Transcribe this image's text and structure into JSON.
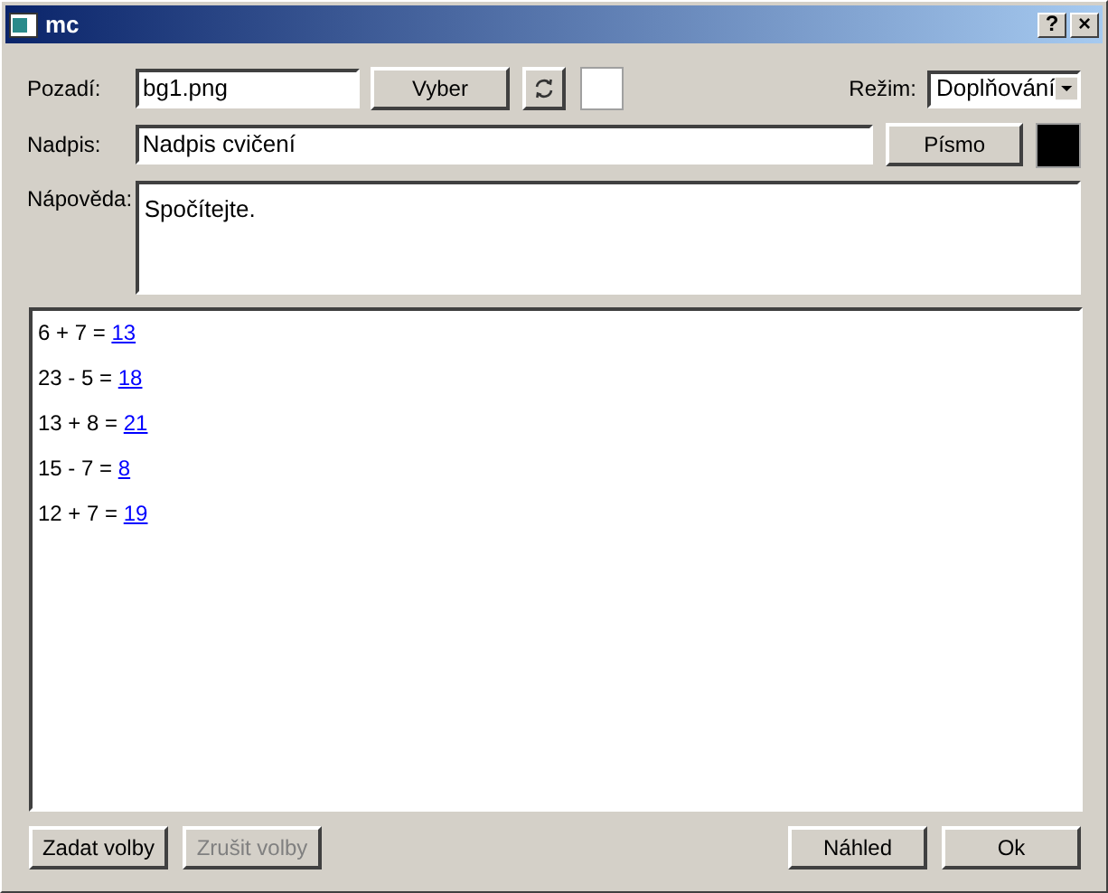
{
  "window": {
    "title": "mc",
    "buttons": [
      "?",
      "×"
    ]
  },
  "background": {
    "label": "Pozadí:",
    "value": "bg1.png",
    "choose_button": "Vyber",
    "color": "#ffffff"
  },
  "mode": {
    "label": "Režim:",
    "value": "Doplňování"
  },
  "caption": {
    "label": "Nadpis:",
    "value": "Nadpis cvičení",
    "font_button": "Písmo",
    "color": "#000000"
  },
  "hint": {
    "label": "Nápověda:",
    "value": "Spočítejte."
  },
  "exercises": [
    {
      "text": "6 + 7 = ",
      "answer": "13"
    },
    {
      "text": "23 - 5 = ",
      "answer": "18"
    },
    {
      "text": "13 + 8 = ",
      "answer": "21"
    },
    {
      "text": "15 - 7 = ",
      "answer": "8"
    },
    {
      "text": "12 + 7 = ",
      "answer": "19"
    }
  ],
  "buttons": [
    {
      "label": "Zadat volby",
      "disabled": false
    },
    {
      "label": "Zrušit volby",
      "disabled": true
    },
    {
      "label": "Náhled",
      "disabled": false
    },
    {
      "label": "Ok",
      "disabled": false
    }
  ]
}
